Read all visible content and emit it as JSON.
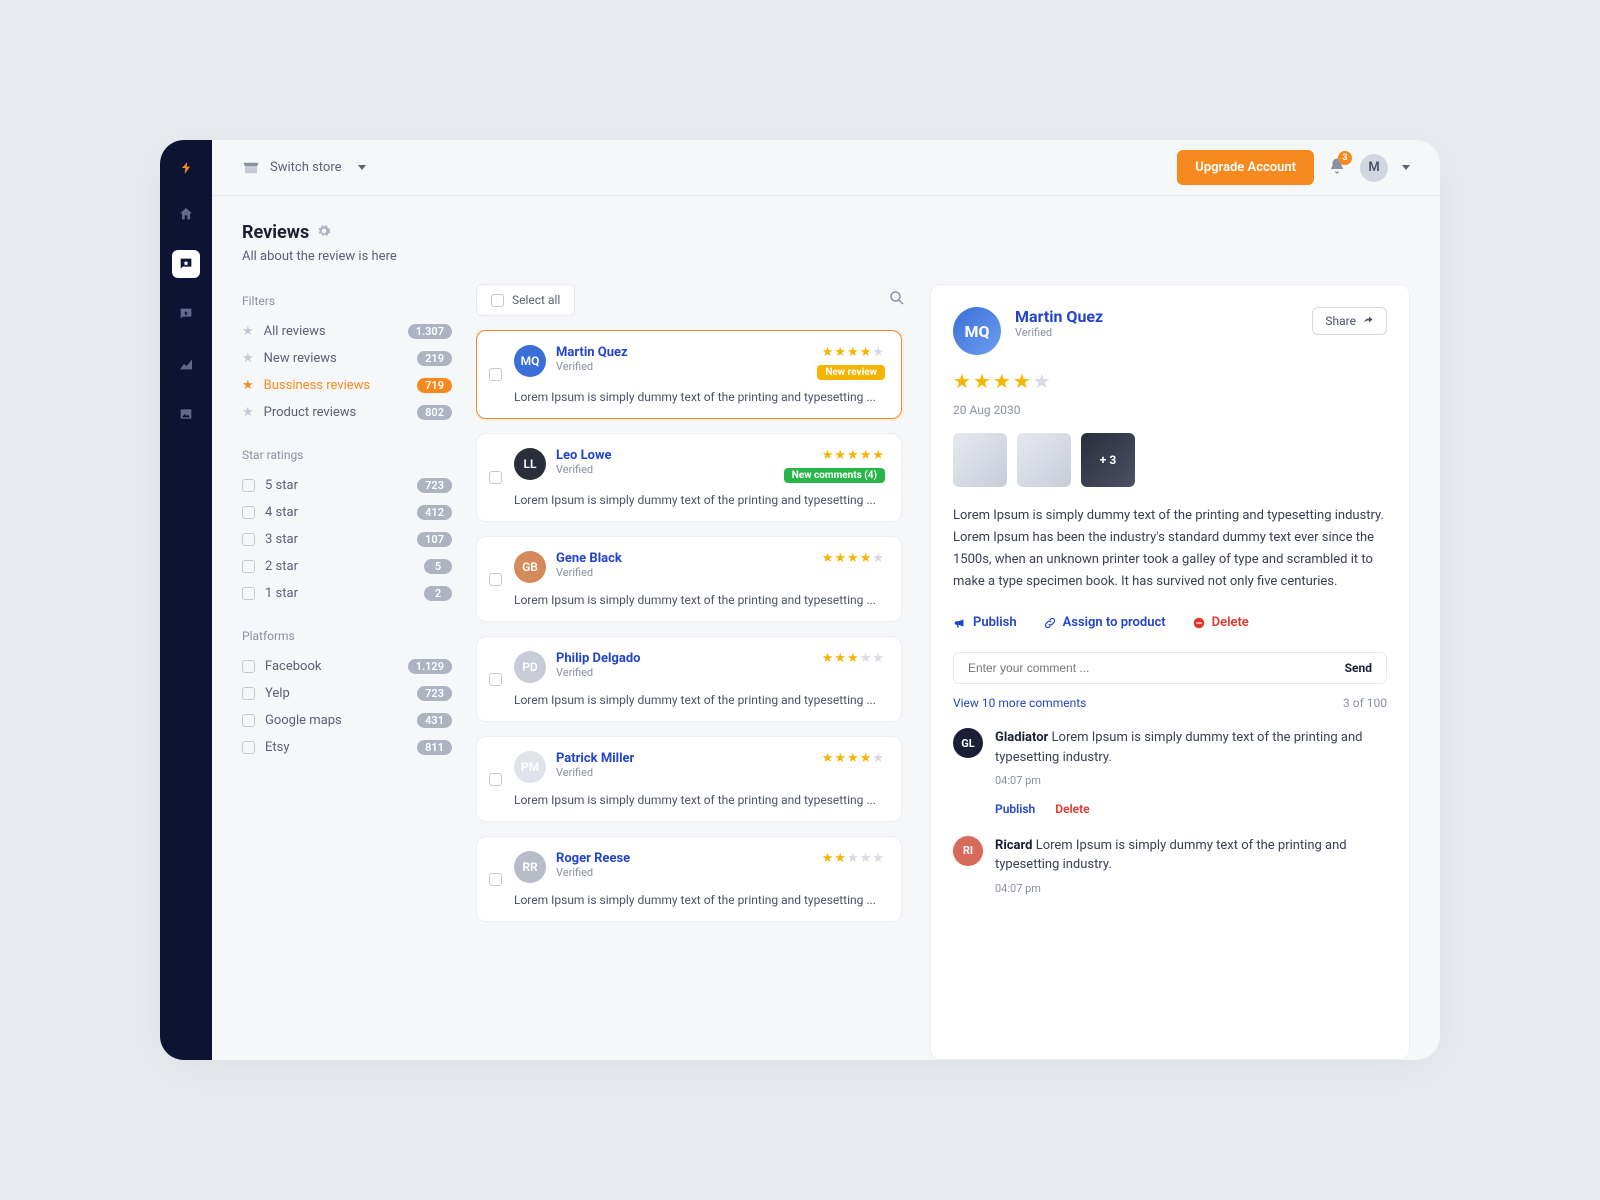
{
  "topbar": {
    "switch_store": "Switch store",
    "upgrade": "Upgrade Account",
    "notif_count": "3",
    "avatar_initial": "M"
  },
  "page": {
    "title": "Reviews",
    "subtitle": "All about the review is here"
  },
  "filters": {
    "filters_head": "Filters",
    "items": [
      {
        "label": "All reviews",
        "count": "1.307"
      },
      {
        "label": "New reviews",
        "count": "219"
      },
      {
        "label": "Bussiness reviews",
        "count": "719",
        "active": true
      },
      {
        "label": "Product reviews",
        "count": "802"
      }
    ],
    "star_head": "Star ratings",
    "stars": [
      {
        "label": "5 star",
        "count": "723"
      },
      {
        "label": "4 star",
        "count": "412"
      },
      {
        "label": "3 star",
        "count": "107"
      },
      {
        "label": "2 star",
        "count": "5"
      },
      {
        "label": "1 star",
        "count": "2"
      }
    ],
    "platform_head": "Platforms",
    "platforms": [
      {
        "label": "Facebook",
        "count": "1.129"
      },
      {
        "label": "Yelp",
        "count": "723"
      },
      {
        "label": "Google maps",
        "count": "431"
      },
      {
        "label": "Etsy",
        "count": "811"
      }
    ]
  },
  "list": {
    "select_all": "Select all",
    "items": [
      {
        "name": "Martin Quez",
        "verified": "Verified",
        "stars": 4,
        "tag": "New  review",
        "tag_color": "yellow",
        "excerpt": "Lorem Ipsum is simply dummy text of the printing and typesetting ...",
        "active": true,
        "avbg": "#3a6fd8"
      },
      {
        "name": "Leo Lowe",
        "verified": "Verified",
        "stars": 5,
        "tag": "New comments (4)",
        "tag_color": "green",
        "excerpt": "Lorem Ipsum is simply dummy text of the printing and typesetting ...",
        "avbg": "#2a2e3b"
      },
      {
        "name": "Gene Black",
        "verified": "Verified",
        "stars": 4,
        "excerpt": "Lorem Ipsum is simply dummy text of the printing and typesetting ...",
        "avbg": "#d48a5a"
      },
      {
        "name": "Philip Delgado",
        "verified": "Verified",
        "stars": 3,
        "excerpt": "Lorem Ipsum is simply dummy text of the printing and typesetting ...",
        "avbg": "#c8ccd8"
      },
      {
        "name": "Patrick Miller",
        "verified": "Verified",
        "stars": 4,
        "excerpt": "Lorem Ipsum is simply dummy text of the printing and typesetting ...",
        "avbg": "#e0e3ea"
      },
      {
        "name": "Roger Reese",
        "verified": "Verified",
        "stars": 2,
        "excerpt": "Lorem Ipsum is simply dummy text of the printing and typesetting ...",
        "avbg": "#b8bcc8"
      }
    ]
  },
  "detail": {
    "name": "Martin Quez",
    "verified": "Verified",
    "share": "Share",
    "stars": 4,
    "date": "20 Aug 2030",
    "more_photos": "+ 3",
    "body": "Lorem Ipsum is simply dummy text of the printing and typesetting industry. Lorem Ipsum has been the industry's standard dummy text ever since the 1500s, when an unknown printer took a galley of type and scrambled it to make a type specimen book. It has survived not only five centuries.",
    "publish": "Publish",
    "assign": "Assign to product",
    "delete": "Delete",
    "comment_ph": "Enter your comment ...",
    "send": "Send",
    "view_more": "View 10 more comments",
    "count": "3 of 100",
    "comments": [
      {
        "name": "Gladiator",
        "text": " Lorem Ipsum is simply dummy text of the printing and typesetting industry.",
        "time": "04:07 pm",
        "actions": true,
        "avbg": "#1a1f36"
      },
      {
        "name": "Ricard",
        "text": " Lorem Ipsum is simply dummy text of the printing and typesetting industry.",
        "time": "04:07 pm",
        "avbg": "#d86a5a"
      }
    ],
    "c_publish": "Publish",
    "c_delete": "Delete"
  }
}
